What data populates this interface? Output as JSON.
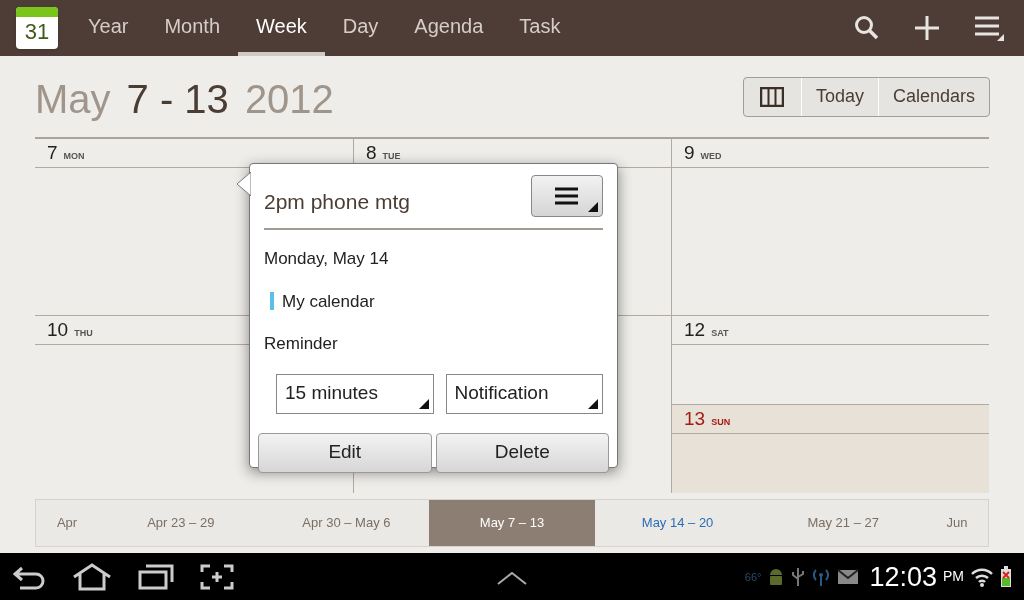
{
  "action_bar": {
    "app_icon_day": "31",
    "tabs": [
      {
        "label": "Year",
        "selected": false
      },
      {
        "label": "Month",
        "selected": false
      },
      {
        "label": "Week",
        "selected": true
      },
      {
        "label": "Day",
        "selected": false
      },
      {
        "label": "Agenda",
        "selected": false
      },
      {
        "label": "Task",
        "selected": false
      }
    ]
  },
  "header": {
    "title_parts": [
      {
        "text": "May",
        "kind": "muted"
      },
      {
        "text": "7 - 13",
        "kind": "strong"
      },
      {
        "text": "2012",
        "kind": "muted"
      }
    ],
    "buttons": [
      {
        "label": "Today"
      },
      {
        "label": "Calendars"
      }
    ]
  },
  "week_cells": [
    {
      "days": [
        {
          "number": "7",
          "weekday": "MON",
          "highlighted": false
        }
      ]
    },
    {
      "days": [
        {
          "number": "8",
          "weekday": "TUE",
          "highlighted": false
        }
      ]
    },
    {
      "days": [
        {
          "number": "9",
          "weekday": "WED",
          "highlighted": false
        }
      ]
    },
    {
      "days": [
        {
          "number": "10",
          "weekday": "THU",
          "highlighted": false
        }
      ]
    },
    {},
    {
      "days": [
        {
          "number": "12",
          "weekday": "SAT",
          "highlighted": false
        },
        {
          "number": "13",
          "weekday": "SUN",
          "highlighted": true
        }
      ]
    }
  ],
  "event_popup": {
    "title": "2pm phone mtg",
    "date": "Monday, May 14",
    "calendar": {
      "name": "My calendar",
      "color": "#5bc0e8"
    },
    "reminder_label": "Reminder",
    "reminder_time": "15 minutes",
    "reminder_method": "Notification",
    "buttons": [
      {
        "label": "Edit"
      },
      {
        "label": "Delete"
      }
    ]
  },
  "week_strip": [
    {
      "label": "Apr",
      "kind": "month",
      "selected": false,
      "current": false
    },
    {
      "label": "Apr 23 – 29",
      "kind": "week",
      "selected": false,
      "current": false
    },
    {
      "label": "Apr 30 – May 6",
      "kind": "week",
      "selected": false,
      "current": false
    },
    {
      "label": "May 7 – 13",
      "kind": "week",
      "selected": true,
      "current": false
    },
    {
      "label": "May 14 – 20",
      "kind": "week",
      "selected": false,
      "current": true
    },
    {
      "label": "May 21 – 27",
      "kind": "week",
      "selected": false,
      "current": false
    },
    {
      "label": "Jun",
      "kind": "month",
      "selected": false,
      "current": false
    }
  ],
  "system_bar": {
    "temperature": "66°",
    "time": "12:03",
    "ampm": "PM"
  }
}
